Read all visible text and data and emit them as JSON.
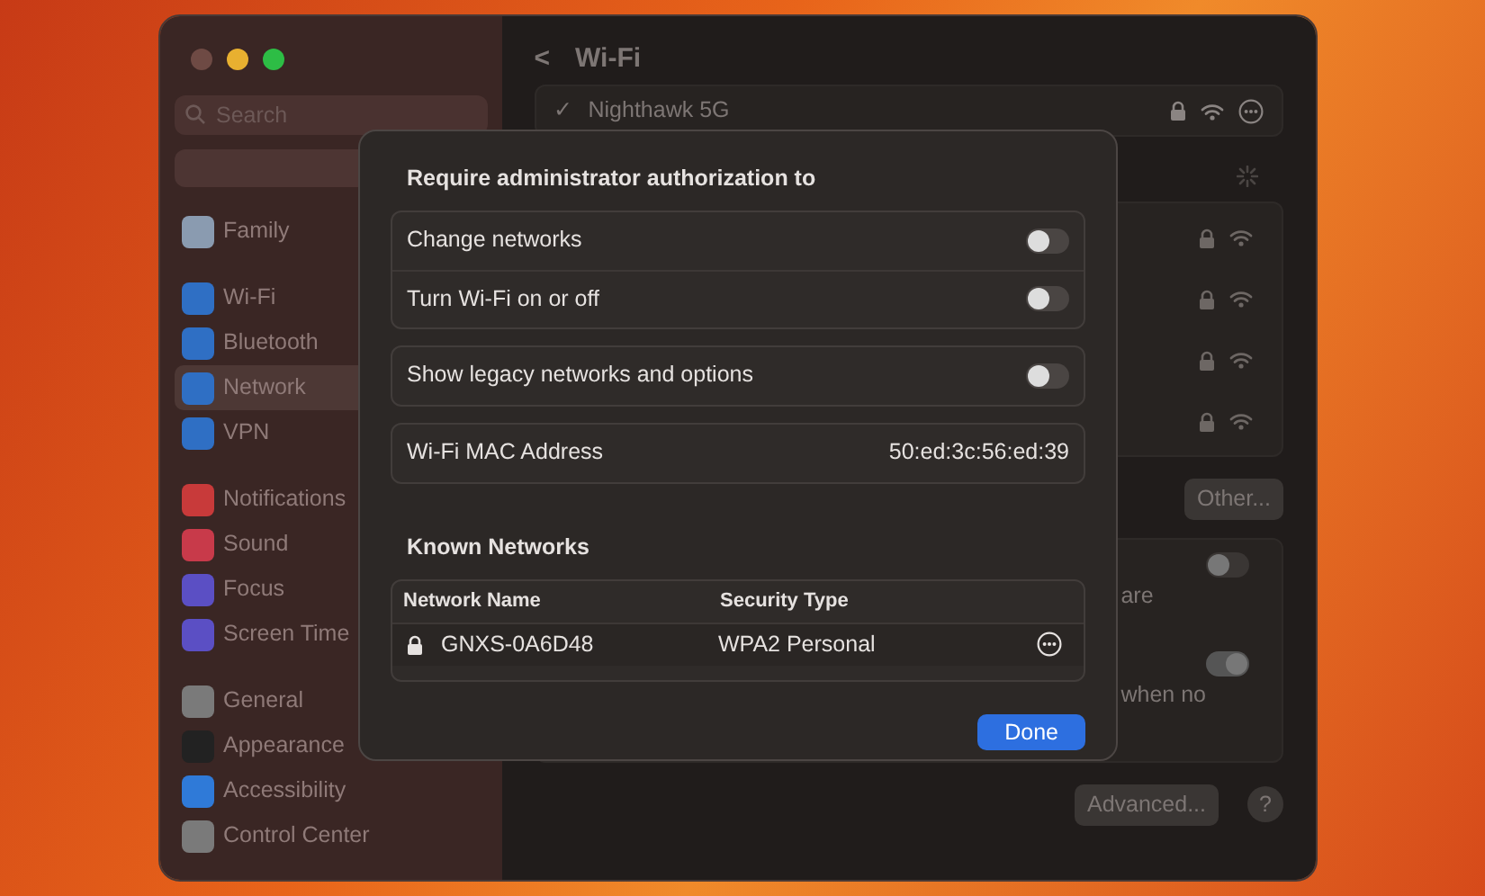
{
  "sidebar": {
    "search": {
      "placeholder": "Search"
    },
    "groups": [
      [
        {
          "label": "Family",
          "color": "#8a9bb0",
          "selected": false
        }
      ],
      [
        {
          "label": "Wi-Fi",
          "color": "#2f6fc4",
          "selected": false
        },
        {
          "label": "Bluetooth",
          "color": "#2f6fc4",
          "selected": false
        },
        {
          "label": "Network",
          "color": "#2f6fc4",
          "selected": true
        },
        {
          "label": "VPN",
          "color": "#2f6fc4",
          "selected": false
        }
      ],
      [
        {
          "label": "Notifications",
          "color": "#c83a3a",
          "selected": false
        },
        {
          "label": "Sound",
          "color": "#c83a4a",
          "selected": false
        },
        {
          "label": "Focus",
          "color": "#5b4fc4",
          "selected": false
        },
        {
          "label": "Screen Time",
          "color": "#5b4fc4",
          "selected": false
        }
      ],
      [
        {
          "label": "General",
          "color": "#7a7a7a",
          "selected": false
        },
        {
          "label": "Appearance",
          "color": "#222222",
          "selected": false
        },
        {
          "label": "Accessibility",
          "color": "#2f7ad8",
          "selected": false
        },
        {
          "label": "Control Center",
          "color": "#7a7a7a",
          "selected": false
        }
      ]
    ]
  },
  "main": {
    "back": "<",
    "title": "Wi-Fi",
    "current_network": {
      "check": "✓",
      "name": "Nighthawk 5G"
    },
    "network_rows": [
      {
        "secured": true
      },
      {
        "secured": true
      },
      {
        "secured": true
      },
      {
        "secured": true
      }
    ],
    "other_button": "Other...",
    "options": [
      {
        "text": "are",
        "on": false
      },
      {
        "text": "when no",
        "on": true
      }
    ],
    "advanced_button": "Advanced...",
    "help_button": "?"
  },
  "dialog": {
    "title": "Require administrator authorization to",
    "groups": [
      [
        {
          "label": "Change networks",
          "on": false
        },
        {
          "label": "Turn Wi-Fi on or off",
          "on": false
        }
      ],
      [
        {
          "label": "Show legacy networks and options",
          "on": false
        }
      ]
    ],
    "mac": {
      "label": "Wi-Fi MAC Address",
      "value": "50:ed:3c:56:ed:39"
    },
    "known_title": "Known Networks",
    "columns": [
      "Network Name",
      "Security Type"
    ],
    "rows": [
      {
        "name": "GNXS-0A6D48",
        "security": "WPA2 Personal"
      }
    ],
    "done": "Done"
  }
}
